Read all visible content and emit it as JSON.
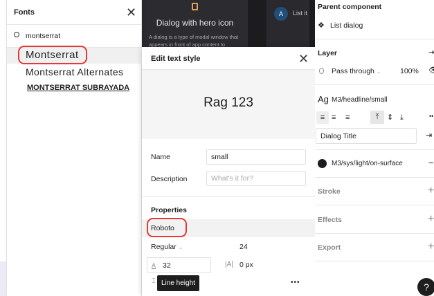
{
  "fonts_panel": {
    "title": "Fonts",
    "search_value": "montserrat",
    "results": [
      "Montserrat",
      "Montserrat Alternates",
      "MONTSERRAT SUBRAYADA"
    ]
  },
  "canvas": {
    "card_title": "Dialog with hero icon",
    "card_desc": "A dialog is a type of modal window that appears in front of app content to",
    "avatar": "A",
    "list_label": "List it"
  },
  "edit_text_style": {
    "title": "Edit text style",
    "preview": "Rag 123",
    "name_label": "Name",
    "name_value": "small",
    "description_label": "Description",
    "description_placeholder": "What's it for?",
    "properties_label": "Properties",
    "font_family": "Roboto",
    "font_weight": "Regular",
    "font_size": "24",
    "line_height": "32",
    "letter_spacing": "0 px",
    "tooltip": "Line height",
    "more": "•••"
  },
  "right_panel": {
    "parent_component_label": "Parent component",
    "parent_component": "List dialog",
    "layer_label": "Layer",
    "blend_mode": "Pass through",
    "opacity": "100%",
    "text_style": "M3/headline/small",
    "text_style_prefix": "Ag",
    "content_value": "Dialog Title",
    "fill_style": "M3/sys/light/on-surface",
    "stroke_label": "Stroke",
    "effects_label": "Effects",
    "export_label": "Export",
    "help": "?"
  }
}
